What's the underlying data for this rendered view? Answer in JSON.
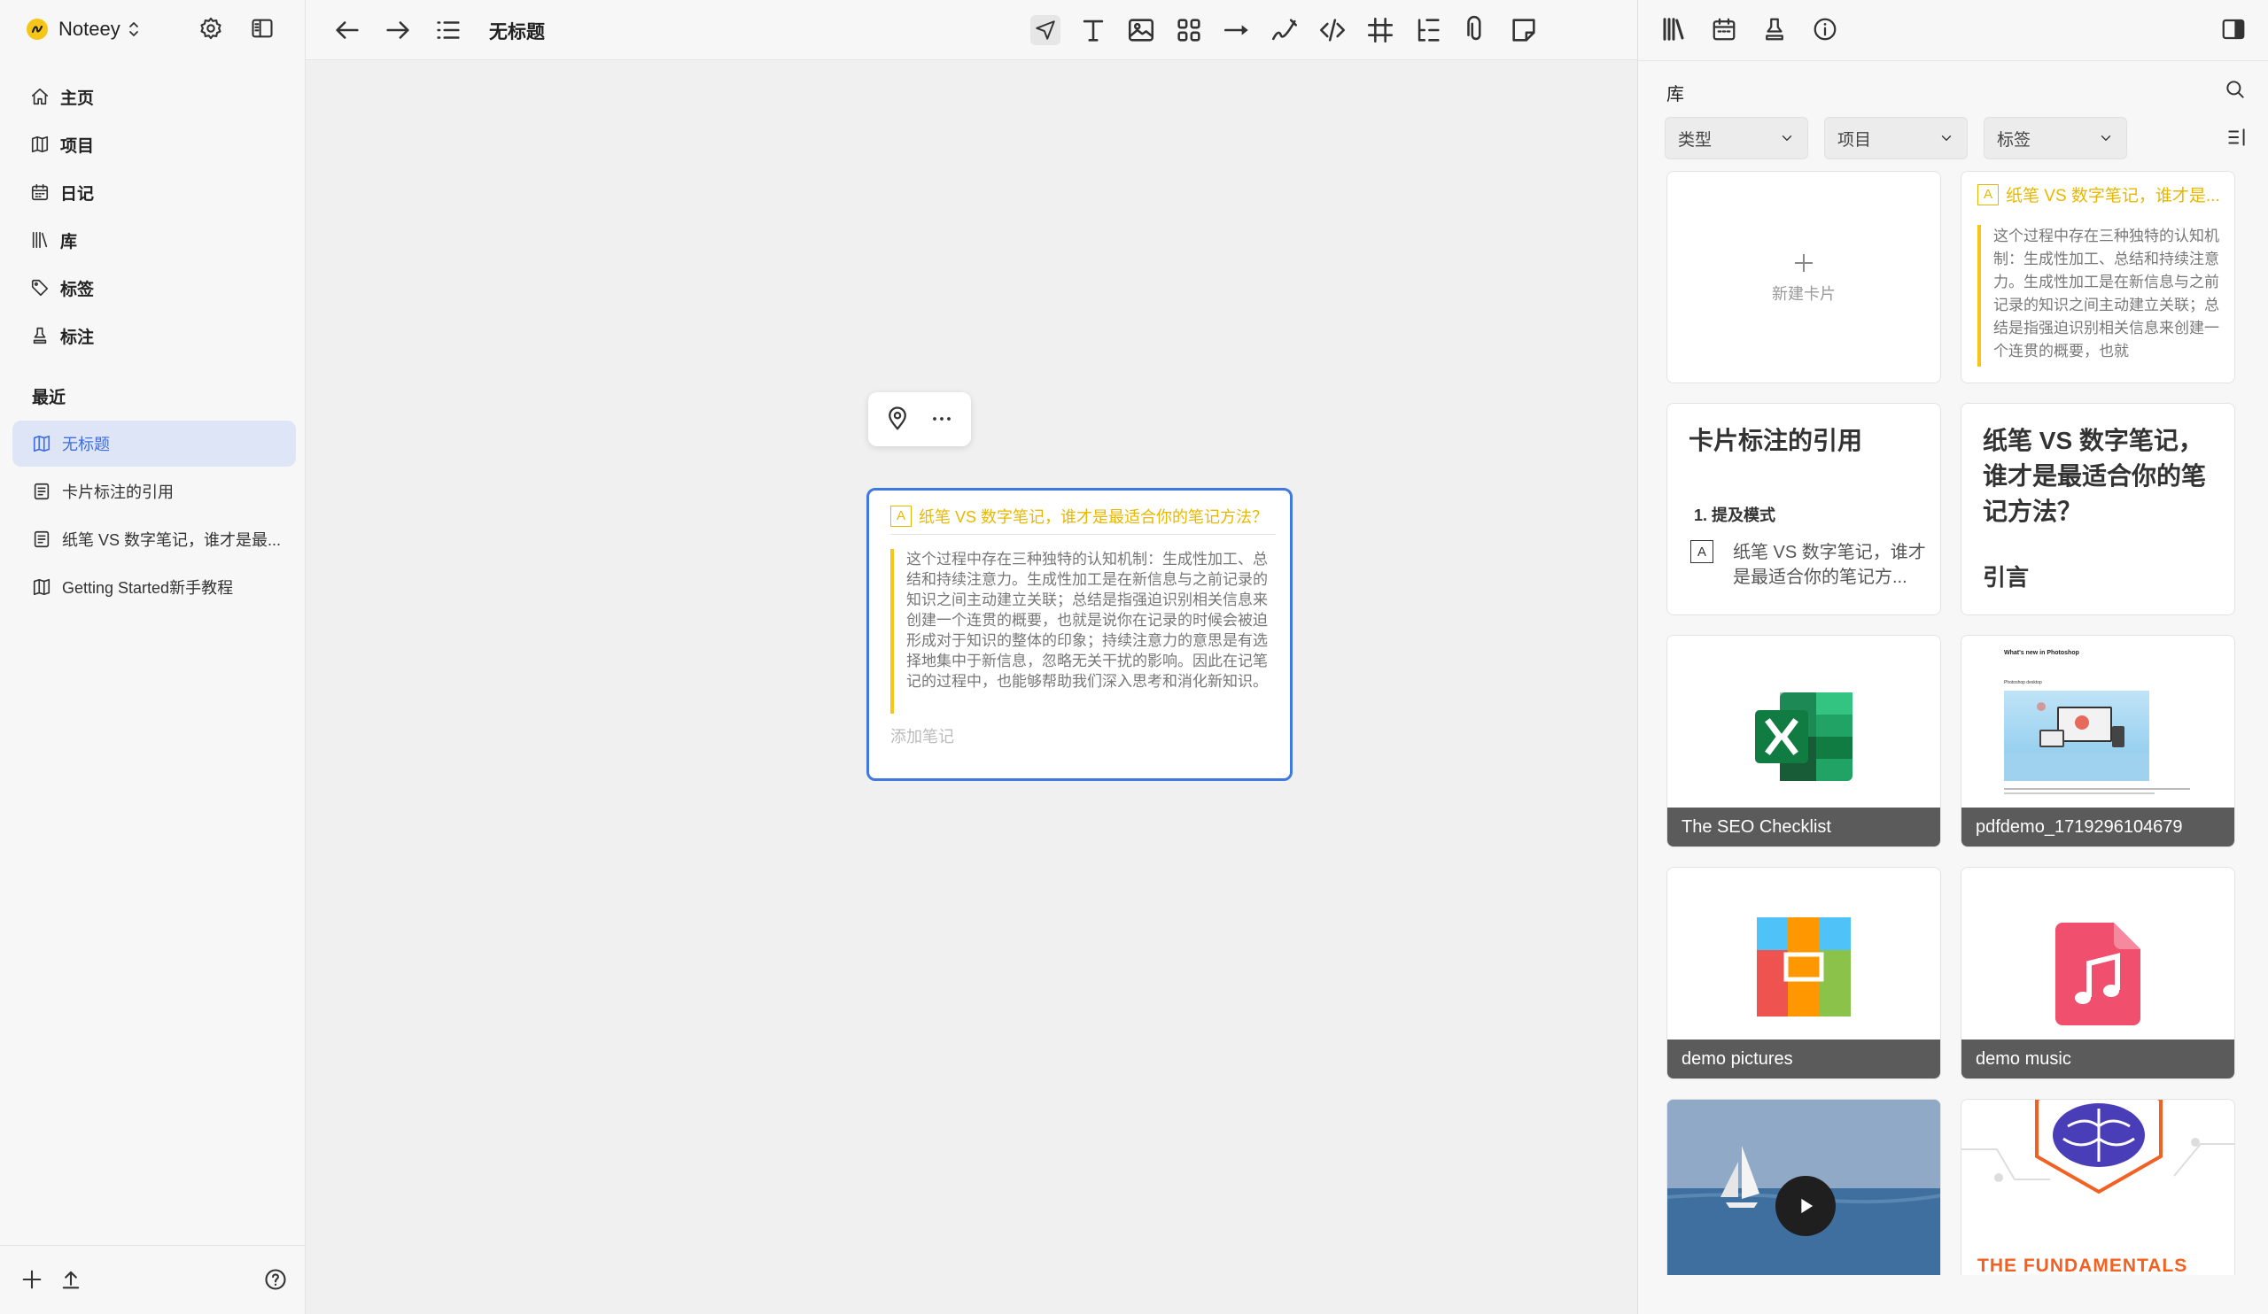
{
  "app": {
    "name": "Noteey"
  },
  "sidebar": {
    "nav": [
      {
        "label": "主页",
        "icon": "home-icon"
      },
      {
        "label": "项目",
        "icon": "map-icon"
      },
      {
        "label": "日记",
        "icon": "calendar-icon"
      },
      {
        "label": "库",
        "icon": "library-icon"
      },
      {
        "label": "标签",
        "icon": "tag-icon"
      },
      {
        "label": "标注",
        "icon": "highlighter-icon"
      }
    ],
    "recent_label": "最近",
    "recent": [
      {
        "label": "无标题",
        "icon": "map-icon",
        "active": true
      },
      {
        "label": "卡片标注的引用",
        "icon": "document-icon",
        "active": false
      },
      {
        "label": "纸笔 VS 数字笔记，谁才是最...",
        "icon": "document-icon",
        "active": false
      },
      {
        "label": "Getting Started新手教程",
        "icon": "map-icon",
        "active": false
      }
    ]
  },
  "toolbar": {
    "title": "无标题"
  },
  "canvas": {
    "note_card": {
      "badge": "A",
      "title": "纸笔 VS 数字笔记，谁才是最适合你的笔记方法？",
      "quote": "这个过程中存在三种独特的认知机制：生成性加工、总结和持续注意力。生成性加工是在新信息与之前记录的知识之间主动建立关联；总结是指强迫识别相关信息来创建一个连贯的概要，也就是说你在记录的时候会被迫形成对于知识的整体的印象；持续注意力的意思是有选择地集中于新信息，忽略无关干扰的影响。因此在记笔记的过程中，也能够帮助我们深入思考和消化新知识。",
      "add_note": "添加笔记"
    }
  },
  "right_panel": {
    "title": "库",
    "filters": [
      "类型",
      "项目",
      "标签"
    ],
    "cards": {
      "new_card": "新建卡片",
      "quote_card": {
        "badge": "A",
        "title": "纸笔 VS 数字笔记，谁才是...",
        "body": "这个过程中存在三种独特的认知机制：生成性加工、总结和持续注意力。生成性加工是在新信息与之前记录的知识之间主动建立关联；总结是指强迫识别相关信息来创建一个连贯的概要，也就"
      },
      "ref_card": {
        "title": "卡片标注的引用",
        "list_item": "1.  提及模式",
        "badge": "A",
        "ref_text": "纸笔 VS 数字笔记，谁才是最适合你的笔记方..."
      },
      "doc_card": {
        "title": "纸笔 VS 数字笔记，谁才是最适合你的笔记方法？",
        "subtitle": "引言"
      },
      "files": [
        {
          "label": "The SEO Checklist",
          "icon": "excel-icon"
        },
        {
          "label": "pdfdemo_1719296104679",
          "icon": "pdf-preview"
        },
        {
          "label": "demo pictures",
          "icon": "image-gallery-icon"
        },
        {
          "label": "demo music",
          "icon": "music-icon"
        }
      ],
      "pdf_preview": {
        "heading": "What's new in Photoshop",
        "subheading": "Photoshop desktop"
      },
      "bottom_right_caption": "THE FUNDAMENTALS"
    }
  }
}
